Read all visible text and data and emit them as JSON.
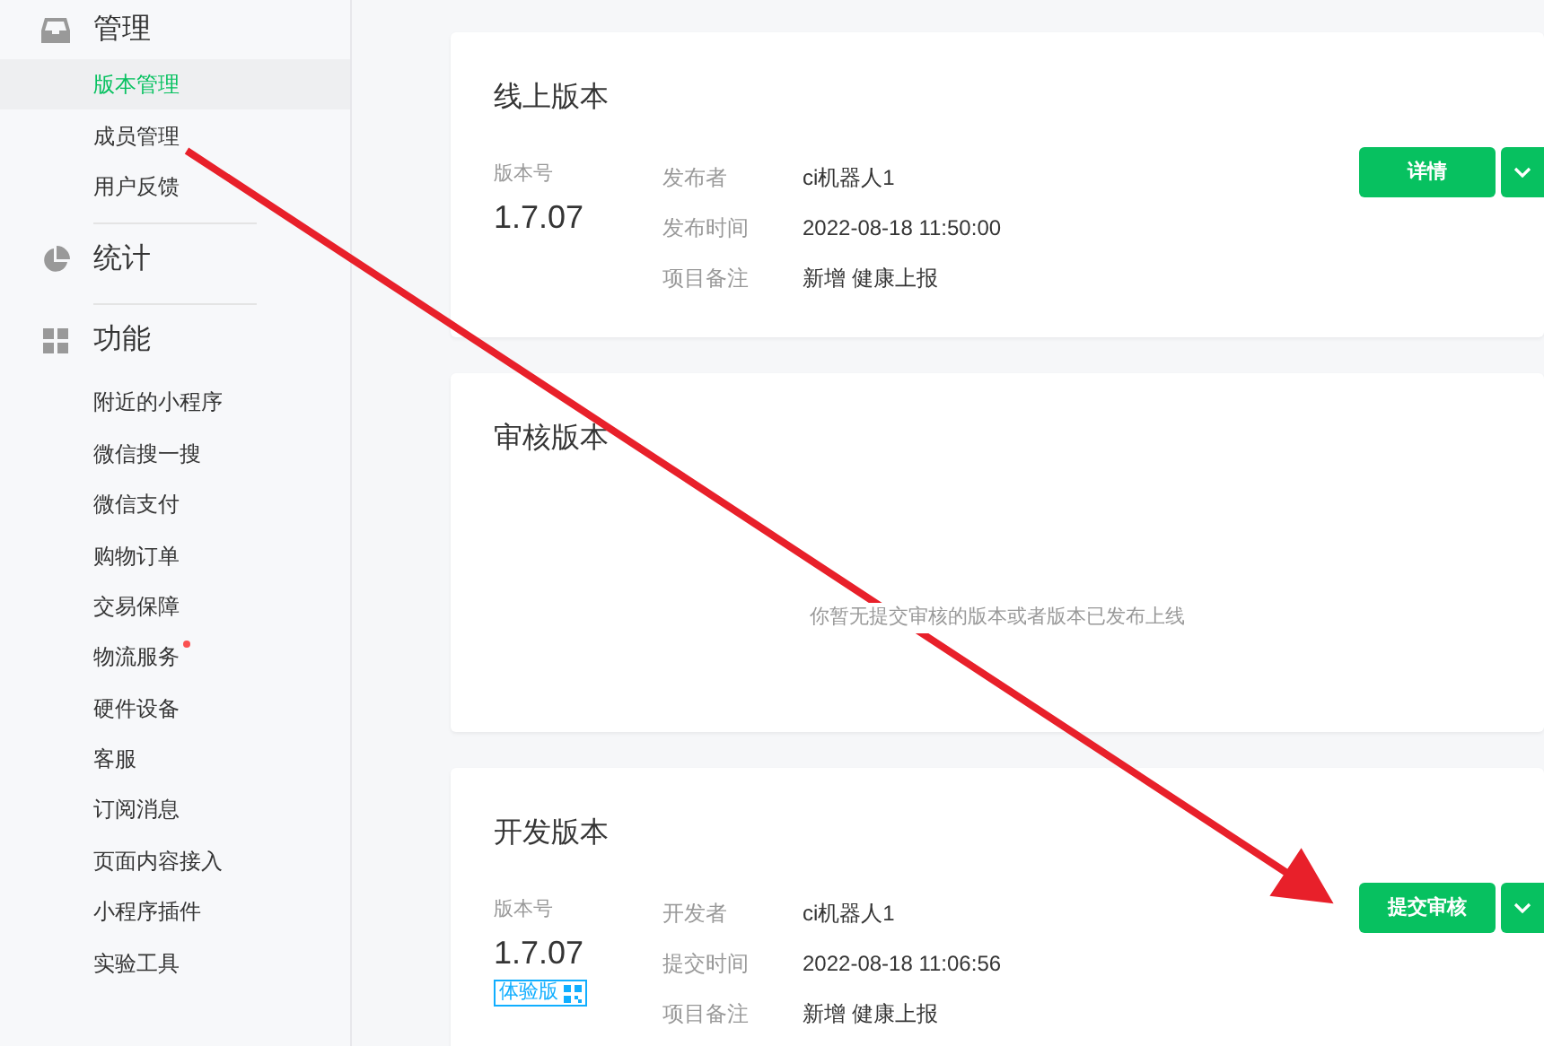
{
  "sidebar": {
    "sections": [
      {
        "title": "管理",
        "items": [
          {
            "label": "版本管理",
            "selected": true,
            "dot": false
          },
          {
            "label": "成员管理",
            "selected": false,
            "dot": false
          },
          {
            "label": "用户反馈",
            "selected": false,
            "dot": false
          }
        ]
      },
      {
        "title": "统计"
      },
      {
        "title": "功能",
        "items": [
          {
            "label": "附近的小程序",
            "selected": false,
            "dot": false
          },
          {
            "label": "微信搜一搜",
            "selected": false,
            "dot": false
          },
          {
            "label": "微信支付",
            "selected": false,
            "dot": false
          },
          {
            "label": "购物订单",
            "selected": false,
            "dot": false
          },
          {
            "label": "交易保障",
            "selected": false,
            "dot": false
          },
          {
            "label": "物流服务",
            "selected": false,
            "dot": true
          },
          {
            "label": "硬件设备",
            "selected": false,
            "dot": false
          },
          {
            "label": "客服",
            "selected": false,
            "dot": false
          },
          {
            "label": "订阅消息",
            "selected": false,
            "dot": false
          },
          {
            "label": "页面内容接入",
            "selected": false,
            "dot": false
          },
          {
            "label": "小程序插件",
            "selected": false,
            "dot": false
          },
          {
            "label": "实验工具",
            "selected": false,
            "dot": false
          }
        ]
      }
    ]
  },
  "cards": [
    {
      "kind": "version",
      "title": "线上版本",
      "version_label": "版本号",
      "version": "1.7.07",
      "fields": [
        {
          "label": "发布者",
          "value": "ci机器人1"
        },
        {
          "label": "发布时间",
          "value": "2022-08-18 11:50:00"
        },
        {
          "label": "项目备注",
          "value": "新增 健康上报"
        }
      ],
      "button": "详情"
    },
    {
      "kind": "empty",
      "title": "审核版本",
      "message": "你暂无提交审核的版本或者版本已发布上线"
    },
    {
      "kind": "version",
      "title": "开发版本",
      "version_label": "版本号",
      "version": "1.7.07",
      "tag": "体验版",
      "fields": [
        {
          "label": "开发者",
          "value": "ci机器人1"
        },
        {
          "label": "提交时间",
          "value": "2022-08-18 11:06:56"
        },
        {
          "label": "项目备注",
          "value": "新增 健康上报"
        }
      ],
      "button": "提交审核"
    }
  ]
}
